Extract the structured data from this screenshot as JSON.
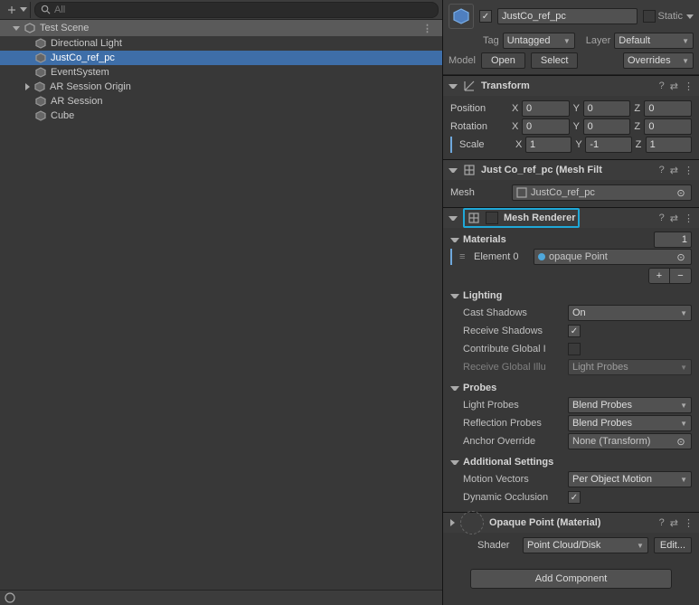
{
  "hierarchy": {
    "search_placeholder": "All",
    "scene_name": "Test Scene",
    "items": [
      {
        "label": "Directional Light"
      },
      {
        "label": "JustCo_ref_pc"
      },
      {
        "label": "EventSystem"
      },
      {
        "label": "AR Session Origin"
      },
      {
        "label": "AR Session"
      },
      {
        "label": "Cube"
      }
    ]
  },
  "inspector": {
    "go_name": "JustCo_ref_pc",
    "static_label": "Static",
    "tag_label": "Tag",
    "tag_value": "Untagged",
    "layer_label": "Layer",
    "layer_value": "Default",
    "model_label": "Model",
    "open_btn": "Open",
    "select_btn": "Select",
    "overrides_label": "Overrides",
    "transform": {
      "title": "Transform",
      "position": {
        "label": "Position",
        "x": "0",
        "y": "0",
        "z": "0"
      },
      "rotation": {
        "label": "Rotation",
        "x": "0",
        "y": "0",
        "z": "0"
      },
      "scale": {
        "label": "Scale",
        "x": "1",
        "y": "-1",
        "z": "1"
      }
    },
    "mesh_filter": {
      "title": "Just Co_ref_pc (Mesh Filt",
      "mesh_label": "Mesh",
      "mesh_value": "JustCo_ref_pc"
    },
    "mesh_renderer": {
      "title": "Mesh Renderer",
      "materials_label": "Materials",
      "materials_count": "1",
      "element0_label": "Element 0",
      "element0_value": "opaque Point",
      "lighting": {
        "title": "Lighting",
        "cast_shadows_label": "Cast Shadows",
        "cast_shadows_value": "On",
        "receive_shadows_label": "Receive Shadows",
        "contribute_gi_label": "Contribute Global I",
        "receive_gi_label": "Receive Global Illu",
        "receive_gi_value": "Light Probes"
      },
      "probes": {
        "title": "Probes",
        "light_probes_label": "Light Probes",
        "light_probes_value": "Blend Probes",
        "reflection_probes_label": "Reflection Probes",
        "reflection_probes_value": "Blend Probes",
        "anchor_label": "Anchor Override",
        "anchor_value": "None (Transform)"
      },
      "additional": {
        "title": "Additional Settings",
        "motion_vectors_label": "Motion Vectors",
        "motion_vectors_value": "Per Object Motion",
        "dynamic_occlusion_label": "Dynamic Occlusion"
      }
    },
    "material": {
      "title": "Opaque Point (Material)",
      "shader_label": "Shader",
      "shader_value": "Point Cloud/Disk",
      "edit_label": "Edit..."
    },
    "add_component": "Add Component"
  }
}
